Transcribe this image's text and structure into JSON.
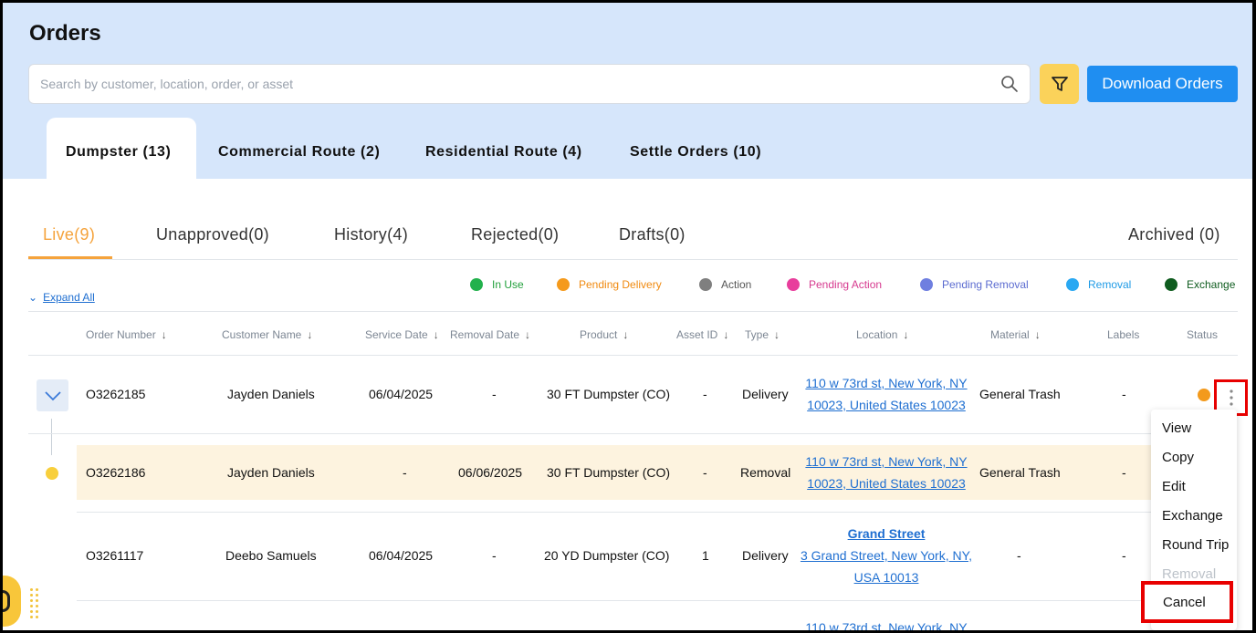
{
  "page": {
    "title": "Orders"
  },
  "search": {
    "placeholder": "Search by customer, location, order, or asset"
  },
  "toolbar": {
    "download_label": "Download Orders"
  },
  "main_tabs": [
    {
      "label": "Dumpster (13)",
      "active": true
    },
    {
      "label": "Commercial Route (2)"
    },
    {
      "label": "Residential Route (4)"
    },
    {
      "label": "Settle Orders (10)"
    }
  ],
  "sub_tabs": [
    {
      "label": "Live(9)",
      "active": true
    },
    {
      "label": "Unapproved(0)"
    },
    {
      "label": "History(4)"
    },
    {
      "label": "Rejected(0)"
    },
    {
      "label": "Drafts(0)"
    },
    {
      "label": "Archived (0)"
    }
  ],
  "expand_all": "Expand All",
  "legend": [
    {
      "label": "In Use",
      "color": "#22b14c",
      "text_color": "#22a03c"
    },
    {
      "label": "Pending Delivery",
      "color": "#f59a1c",
      "text_color": "#f08a10"
    },
    {
      "label": "Action",
      "color": "#7f7f7f",
      "text_color": "#555555"
    },
    {
      "label": "Pending Action",
      "color": "#e83e9c",
      "text_color": "#d63a8f"
    },
    {
      "label": "Pending Removal",
      "color": "#6f7fe0",
      "text_color": "#5b6bd0"
    },
    {
      "label": "Removal",
      "color": "#2aa8f2",
      "text_color": "#1f9be6"
    },
    {
      "label": "Exchange",
      "color": "#0f5c1f",
      "text_color": "#0f5c1f"
    }
  ],
  "columns": [
    {
      "label": "Order Number",
      "sortable": true
    },
    {
      "label": "Customer Name",
      "sortable": true
    },
    {
      "label": "Service Date",
      "sortable": true
    },
    {
      "label": "Removal Date",
      "sortable": true
    },
    {
      "label": "Product",
      "sortable": true
    },
    {
      "label": "Asset ID",
      "sortable": true
    },
    {
      "label": "Type",
      "sortable": true
    },
    {
      "label": "Location",
      "sortable": true
    },
    {
      "label": "Material",
      "sortable": true
    },
    {
      "label": "Labels",
      "sortable": false
    },
    {
      "label": "Status",
      "sortable": false
    }
  ],
  "rows": [
    {
      "order": "O3262185",
      "customer": "Jayden Daniels",
      "service_date": "06/04/2025",
      "removal_date": "-",
      "product": "30 FT Dumpster (CO)",
      "asset_id": "-",
      "type": "Delivery",
      "location_line1": "110 w 73rd st, New York, NY",
      "location_line2": "10023, United States 10023",
      "material": "General Trash",
      "labels": "-",
      "status_color": "#f39a1c"
    },
    {
      "order": "O3262186",
      "customer": "Jayden Daniels",
      "service_date": "-",
      "removal_date": "06/06/2025",
      "product": "30 FT Dumpster (CO)",
      "asset_id": "-",
      "type": "Removal",
      "location_line1": "110 w 73rd st, New York, NY",
      "location_line2": "10023, United States 10023",
      "material": "General Trash",
      "labels": "-"
    },
    {
      "order": "O3261117",
      "customer": "Deebo Samuels",
      "service_date": "06/04/2025",
      "removal_date": "-",
      "product": "20 YD Dumpster (CO)",
      "asset_id": "1",
      "type": "Delivery",
      "location_name": "Grand Street",
      "location_line1": "3 Grand Street, New York, NY,",
      "location_line2": "USA 10013",
      "material": "-",
      "labels": "-"
    },
    {
      "location_line1": "110 w 73rd st, New York, NY"
    }
  ],
  "action_menu": {
    "items": [
      {
        "label": "View"
      },
      {
        "label": "Copy"
      },
      {
        "label": "Edit"
      },
      {
        "label": "Exchange"
      },
      {
        "label": "Round Trip"
      },
      {
        "label": "Removal",
        "disabled": true
      },
      {
        "label": "Cancel",
        "highlighted": true
      }
    ]
  }
}
